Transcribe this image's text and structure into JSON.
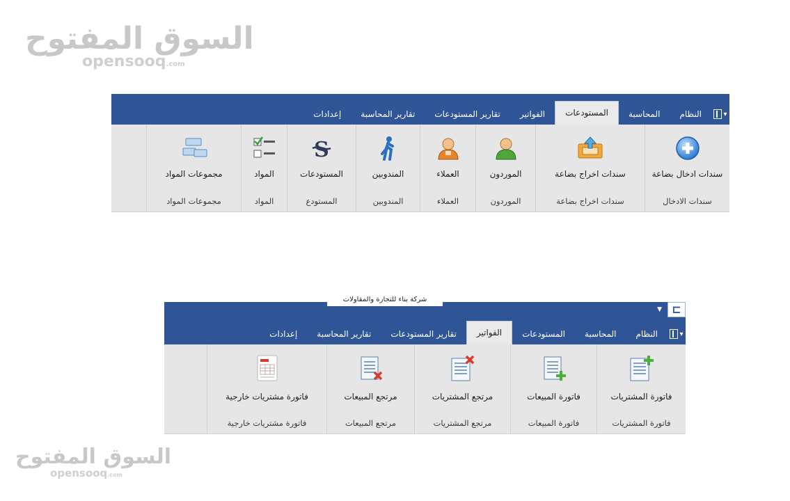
{
  "watermark": {
    "arabic": "السوق المفتوح",
    "latin": "opensooq",
    "suffix": ".com"
  },
  "ribbon_warehouses": {
    "tabs": [
      {
        "label": "النظام",
        "active": false
      },
      {
        "label": "المحاسبة",
        "active": false
      },
      {
        "label": "المستودعات",
        "active": true
      },
      {
        "label": "الفواتير",
        "active": false
      },
      {
        "label": "تقارير المستودعات",
        "active": false
      },
      {
        "label": "تقارير المحاسبة",
        "active": false
      },
      {
        "label": "إعدادات",
        "active": false
      }
    ],
    "groups": [
      {
        "button": "سندات ادخال بضاعة",
        "group": "سندات الادخال",
        "icon": "add-circle-icon"
      },
      {
        "button": "سندات اخراج بضاعة",
        "group": "سندات اخراج بضاعة",
        "icon": "export-tray-icon"
      },
      {
        "button": "الموردون",
        "group": "الموردون",
        "icon": "supplier-person-icon"
      },
      {
        "button": "العملاء",
        "group": "العملاء",
        "icon": "customer-person-icon"
      },
      {
        "button": "المندوبين",
        "group": "المندوبين",
        "icon": "walking-person-icon"
      },
      {
        "button": "المستودعات",
        "group": "المستودع",
        "icon": "warehouse-s-icon"
      },
      {
        "button": "المواد",
        "group": "المواد",
        "icon": "checklist-icon"
      },
      {
        "button": "مجموعات المواد",
        "group": "مجموعات المواد",
        "icon": "item-groups-icon"
      }
    ]
  },
  "ribbon_invoices": {
    "title": "شركة بناء للتجارة والمقاولات",
    "tabs": [
      {
        "label": "النظام",
        "active": false
      },
      {
        "label": "المحاسبة",
        "active": false
      },
      {
        "label": "المستودعات",
        "active": false
      },
      {
        "label": "الفواتير",
        "active": true
      },
      {
        "label": "تقارير المستودعات",
        "active": false
      },
      {
        "label": "تقارير المحاسبة",
        "active": false
      },
      {
        "label": "إعدادات",
        "active": false
      }
    ],
    "groups": [
      {
        "button": "فاتورة المشتريات",
        "group": "فاتورة المشتريات",
        "icon": "purchase-invoice-icon"
      },
      {
        "button": "فاتورة المبيعات",
        "group": "فاتورة المبيعات",
        "icon": "sales-invoice-icon"
      },
      {
        "button": "مرتجع المشتريات",
        "group": "مرتجع المشتريات",
        "icon": "purchase-return-icon"
      },
      {
        "button": "مرتجع المبيعات",
        "group": "مرتجع المبيعات",
        "icon": "sales-return-icon"
      },
      {
        "button": "فاتورة مشتريات خارجية",
        "group": "فاتورة مشتريات خارجية",
        "icon": "external-invoice-icon"
      }
    ]
  },
  "colors": {
    "tabbar": "#2f5597",
    "ribbon_body": "#e6e6e6",
    "active_tab": "#eaeaea"
  }
}
